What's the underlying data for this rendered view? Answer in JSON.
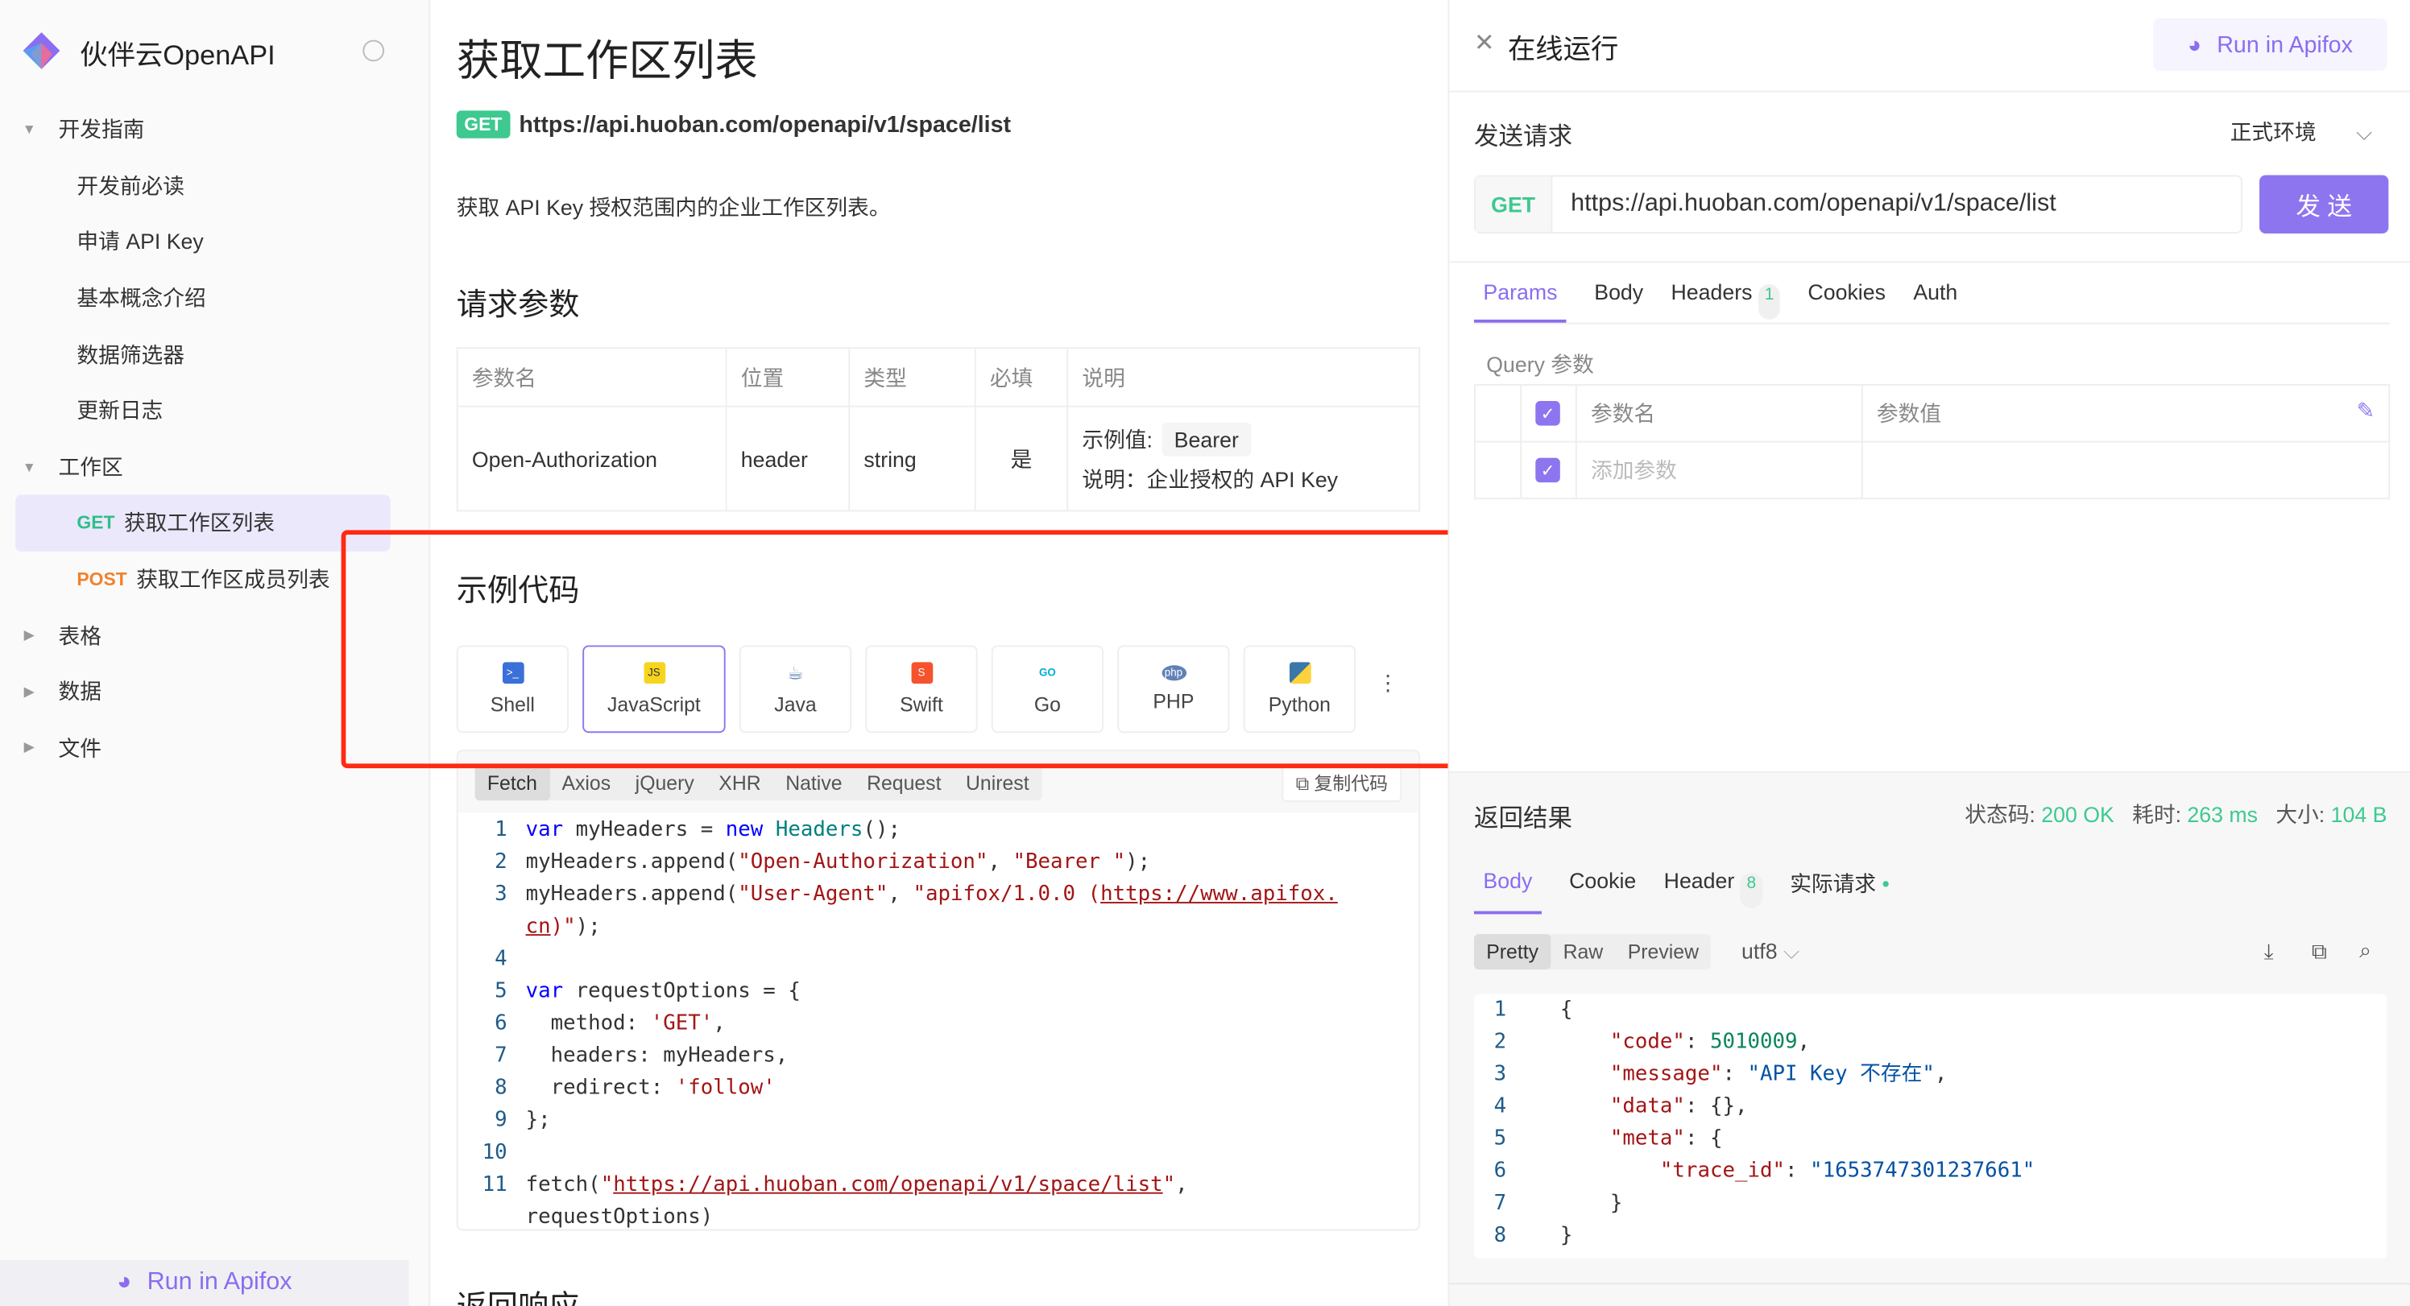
{
  "sidebar": {
    "brand": "伙伴云OpenAPI",
    "groups": [
      {
        "label": "开发指南",
        "items": [
          "开发前必读",
          "申请 API Key",
          "基本概念介绍",
          "数据筛选器",
          "更新日志"
        ]
      },
      {
        "label": "工作区",
        "items": [
          {
            "method": "GET",
            "label": "获取工作区列表"
          },
          {
            "method": "POST",
            "label": "获取工作区成员列表"
          }
        ]
      },
      {
        "label": "表格"
      },
      {
        "label": "数据"
      },
      {
        "label": "文件"
      }
    ],
    "run": "Run in Apifox"
  },
  "main": {
    "title": "获取工作区列表",
    "method": "GET",
    "url": "https://api.huoban.com/openapi/v1/space/list",
    "desc": "获取 API Key 授权范围内的企业工作区列表。",
    "params_title": "请求参数",
    "headers": [
      "参数名",
      "位置",
      "类型",
      "必填",
      "说明"
    ],
    "row": {
      "name": "Open-Authorization",
      "in": "header",
      "type": "string",
      "required": "是",
      "example_label": "示例值:",
      "example": "Bearer",
      "note": "说明：企业授权的 API Key"
    },
    "sample_title": "示例代码",
    "langs": [
      "Shell",
      "JavaScript",
      "Java",
      "Swift",
      "Go",
      "PHP",
      "Python"
    ],
    "libs": [
      "Fetch",
      "Axios",
      "jQuery",
      "XHR",
      "Native",
      "Request",
      "Unirest"
    ],
    "copy": "复制代码",
    "next_title": "返回响应"
  },
  "right": {
    "title": "在线运行",
    "run": "Run in Apifox",
    "send_title": "发送请求",
    "env": "正式环境",
    "method": "GET",
    "url": "https://api.huoban.com/openapi/v1/space/list",
    "send": "发 送",
    "tabs": [
      "Params",
      "Body",
      "Headers",
      "Cookies",
      "Auth"
    ],
    "headers_count": "1",
    "query_title": "Query 参数",
    "col_name": "参数名",
    "col_value": "参数值",
    "add_param": "添加参数",
    "result_title": "返回结果",
    "status_label": "状态码:",
    "status": "200 OK",
    "time_label": "耗时:",
    "time": "263 ms",
    "size_label": "大小:",
    "size": "104 B",
    "rtabs": [
      "Body",
      "Cookie",
      "Header",
      "实际请求"
    ],
    "rheader_count": "8",
    "views": [
      "Pretty",
      "Raw",
      "Preview"
    ],
    "encoding": "utf8"
  },
  "colors": {
    "accent": "#8e75f0",
    "get": "#3dc98f",
    "post": "#f0822d",
    "highlight": "#ff2a12"
  }
}
